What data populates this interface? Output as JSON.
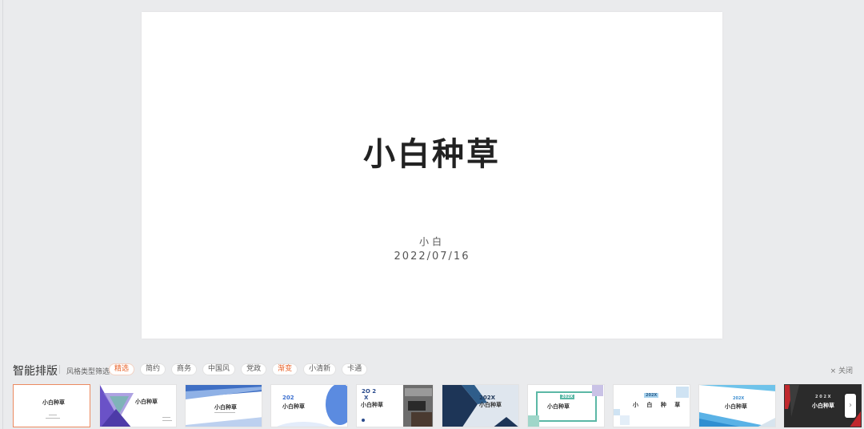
{
  "slide": {
    "title": "小白种草",
    "author": "小白",
    "date": "2022/07/16"
  },
  "panel": {
    "title": "智能排版",
    "filter_label": "风格类型筛选",
    "chips": [
      "精选",
      "简约",
      "商务",
      "中国风",
      "党政",
      "渐变",
      "小清新",
      "卡通"
    ],
    "active_chip": "精选",
    "close_label": "× 关闭"
  },
  "templates": [
    {
      "title": "小白种草"
    },
    {
      "title": "小白种草"
    },
    {
      "title": "小白种草"
    },
    {
      "year": "202",
      "title": "小白种草"
    },
    {
      "year": "2O 2",
      "x": "X",
      "title": "小白种草"
    },
    {
      "year": "202X",
      "title": "小白种草"
    },
    {
      "year": "202X",
      "title": "小白种草"
    },
    {
      "year": "202X",
      "title": "小 白 种 草"
    },
    {
      "year": "202X",
      "title": "小白种草"
    },
    {
      "year": "2 0 2 X",
      "title": "小白种草"
    }
  ],
  "next_icon": "chevron-right-icon"
}
